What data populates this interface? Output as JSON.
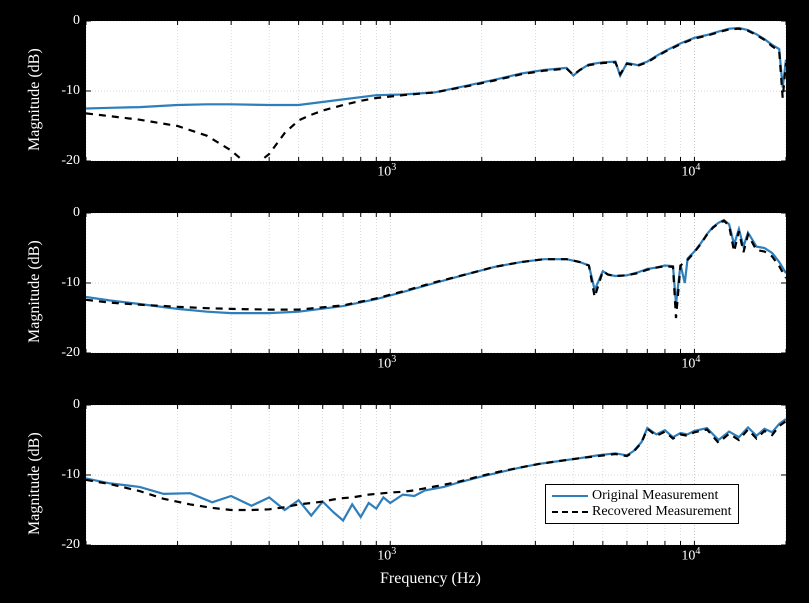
{
  "chart_data": [
    {
      "type": "line",
      "xscale": "log",
      "xlim": [
        100,
        20000
      ],
      "ylim": [
        -20,
        0
      ],
      "y_ticks": [
        -20,
        -10,
        0
      ],
      "x_ticks": [
        1000,
        10000
      ],
      "x_tick_labels": [
        "10^3",
        "10^4"
      ],
      "ylabel": "Magnitude (dB)",
      "series": [
        {
          "name": "Original Measurement",
          "style": "solid-blue",
          "x": [
            100,
            120,
            150,
            200,
            250,
            300,
            400,
            500,
            700,
            900,
            1100,
            1400,
            1800,
            2200,
            2700,
            3200,
            3800,
            4000,
            4200,
            4500,
            5000,
            5500,
            5700,
            6000,
            6500,
            7000,
            7500,
            8000,
            9000,
            10000,
            11000,
            12000,
            13000,
            14000,
            15000,
            16000,
            17000,
            18000,
            19000,
            19500,
            20000
          ],
          "y": [
            -12.5,
            -12.4,
            -12.3,
            -12.0,
            -11.9,
            -11.9,
            -12.0,
            -12.0,
            -11.2,
            -10.6,
            -10.5,
            -10.2,
            -9.2,
            -8.4,
            -7.5,
            -7.0,
            -6.7,
            -7.8,
            -7.0,
            -6.2,
            -5.9,
            -5.8,
            -7.8,
            -6.0,
            -6.3,
            -5.8,
            -5.0,
            -4.3,
            -3.2,
            -2.4,
            -2.0,
            -1.5,
            -1.1,
            -1.0,
            -1.3,
            -1.9,
            -2.6,
            -3.4,
            -4.0,
            -9.5,
            -5.5
          ]
        },
        {
          "name": "Recovered Measurement",
          "style": "dashed-black",
          "x": [
            100,
            120,
            150,
            200,
            250,
            300,
            350,
            400,
            450,
            500,
            550,
            600,
            700,
            800,
            900,
            1100,
            1400,
            1800,
            2200,
            2700,
            3200,
            3800,
            4000,
            4200,
            4500,
            5000,
            5500,
            5700,
            6000,
            6500,
            7000,
            7500,
            8000,
            9000,
            10000,
            11000,
            12000,
            13000,
            14000,
            15000,
            16000,
            17000,
            18000,
            19000,
            19500,
            20000
          ],
          "y": [
            -13.2,
            -13.6,
            -14.1,
            -15.0,
            -16.4,
            -18.5,
            -21.0,
            -19.0,
            -16.0,
            -14.2,
            -13.4,
            -12.8,
            -12.0,
            -11.4,
            -11.0,
            -10.6,
            -10.2,
            -9.3,
            -8.5,
            -7.6,
            -7.1,
            -6.8,
            -7.7,
            -7.0,
            -6.3,
            -6.0,
            -5.9,
            -7.6,
            -6.1,
            -6.4,
            -5.9,
            -5.1,
            -4.4,
            -3.3,
            -2.5,
            -2.1,
            -1.6,
            -1.2,
            -1.1,
            -1.4,
            -2.0,
            -2.7,
            -3.6,
            -4.3,
            -11.0,
            -6.0
          ]
        }
      ]
    },
    {
      "type": "line",
      "xscale": "log",
      "xlim": [
        100,
        20000
      ],
      "ylim": [
        -20,
        0
      ],
      "y_ticks": [
        -20,
        -10,
        0
      ],
      "x_ticks": [
        1000,
        10000
      ],
      "x_tick_labels": [
        "10^3",
        "10^4"
      ],
      "ylabel": "Magnitude (dB)",
      "series": [
        {
          "name": "Original Measurement",
          "style": "solid-blue",
          "x": [
            100,
            120,
            150,
            200,
            250,
            300,
            400,
            500,
            700,
            900,
            1100,
            1400,
            1800,
            2200,
            2700,
            3200,
            3800,
            4200,
            4500,
            4700,
            5000,
            5200,
            5500,
            6000,
            6500,
            7000,
            7500,
            8000,
            8500,
            8700,
            9000,
            9300,
            9500,
            10000,
            10500,
            11000,
            11500,
            12000,
            12500,
            13000,
            13500,
            14000,
            14500,
            15000,
            16000,
            17000,
            18000,
            19000,
            20000
          ],
          "y": [
            -12.0,
            -12.5,
            -13.0,
            -13.7,
            -14.1,
            -14.3,
            -14.3,
            -14.1,
            -13.3,
            -12.3,
            -11.3,
            -10.0,
            -8.7,
            -7.7,
            -7.0,
            -6.6,
            -6.6,
            -7.0,
            -7.5,
            -11.0,
            -8.3,
            -8.8,
            -9.0,
            -8.9,
            -8.5,
            -8.0,
            -7.8,
            -7.5,
            -7.6,
            -13.0,
            -7.4,
            -10.0,
            -6.5,
            -5.5,
            -4.3,
            -3.0,
            -2.0,
            -1.4,
            -1.0,
            -1.6,
            -4.5,
            -2.3,
            -4.8,
            -2.8,
            -4.8,
            -5.0,
            -5.7,
            -7.0,
            -8.6
          ]
        },
        {
          "name": "Recovered Measurement",
          "style": "dashed-black",
          "x": [
            100,
            120,
            150,
            200,
            250,
            300,
            400,
            500,
            700,
            900,
            1100,
            1400,
            1800,
            2200,
            2700,
            3200,
            3800,
            4200,
            4500,
            4700,
            5000,
            5200,
            5500,
            6000,
            6500,
            7000,
            7500,
            8000,
            8500,
            8700,
            9000,
            9300,
            9500,
            10000,
            10500,
            11000,
            11500,
            12000,
            12500,
            13000,
            13500,
            14000,
            14500,
            15000,
            16000,
            17000,
            18000,
            19000,
            20000
          ],
          "y": [
            -12.4,
            -12.8,
            -13.1,
            -13.4,
            -13.6,
            -13.7,
            -13.8,
            -13.8,
            -13.2,
            -12.2,
            -11.2,
            -9.9,
            -8.7,
            -7.7,
            -7.0,
            -6.6,
            -6.6,
            -7.0,
            -7.5,
            -12.0,
            -8.3,
            -8.8,
            -9.0,
            -8.9,
            -8.6,
            -8.1,
            -7.8,
            -7.6,
            -7.7,
            -15.0,
            -7.5,
            -7.0,
            -6.7,
            -5.6,
            -4.4,
            -3.1,
            -2.1,
            -1.5,
            -1.1,
            -1.8,
            -5.5,
            -2.6,
            -5.6,
            -3.1,
            -5.3,
            -5.5,
            -6.2,
            -7.6,
            -9.3
          ]
        }
      ]
    },
    {
      "type": "line",
      "xscale": "log",
      "xlim": [
        100,
        20000
      ],
      "ylim": [
        -20,
        0
      ],
      "y_ticks": [
        -20,
        -10,
        0
      ],
      "x_ticks": [
        1000,
        10000
      ],
      "x_tick_labels": [
        "10^3",
        "10^4"
      ],
      "ylabel": "Magnitude (dB)",
      "xlabel": "Frequency (Hz)",
      "legend": {
        "items": [
          "Original Measurement",
          "Recovered Measurement"
        ]
      },
      "series": [
        {
          "name": "Original Measurement",
          "style": "solid-blue",
          "x": [
            100,
            120,
            150,
            180,
            220,
            260,
            300,
            350,
            400,
            450,
            500,
            550,
            600,
            650,
            700,
            750,
            800,
            850,
            900,
            950,
            1000,
            1100,
            1200,
            1300,
            1500,
            1700,
            2000,
            2300,
            2700,
            3100,
            3600,
            4200,
            4800,
            5500,
            6000,
            6300,
            6700,
            7000,
            7500,
            8000,
            8500,
            9000,
            9500,
            10000,
            11000,
            12000,
            13000,
            14000,
            15000,
            16000,
            17000,
            18000,
            19000,
            20000
          ],
          "y": [
            -10.5,
            -11.2,
            -11.7,
            -12.7,
            -12.6,
            -13.9,
            -13.0,
            -14.4,
            -13.2,
            -15.0,
            -13.6,
            -15.8,
            -13.8,
            -15.3,
            -16.5,
            -14.2,
            -16.0,
            -14.0,
            -14.8,
            -13.2,
            -14.0,
            -12.8,
            -13.0,
            -12.2,
            -11.7,
            -11.0,
            -10.2,
            -9.6,
            -8.9,
            -8.4,
            -8.0,
            -7.6,
            -7.2,
            -6.9,
            -7.2,
            -6.6,
            -5.3,
            -3.3,
            -4.2,
            -3.6,
            -4.6,
            -4.0,
            -4.2,
            -3.7,
            -3.3,
            -5.0,
            -3.8,
            -4.6,
            -3.2,
            -4.4,
            -3.4,
            -3.9,
            -2.7,
            -2.0
          ]
        },
        {
          "name": "Recovered Measurement",
          "style": "dashed-black",
          "x": [
            100,
            120,
            150,
            180,
            220,
            260,
            300,
            350,
            400,
            450,
            500,
            550,
            600,
            650,
            700,
            750,
            800,
            850,
            900,
            950,
            1000,
            1100,
            1200,
            1300,
            1500,
            1700,
            2000,
            2300,
            2700,
            3100,
            3600,
            4200,
            4800,
            5500,
            6000,
            6300,
            6700,
            7000,
            7500,
            8000,
            8500,
            9000,
            9500,
            10000,
            11000,
            12000,
            13000,
            14000,
            15000,
            16000,
            17000,
            18000,
            19000,
            20000
          ],
          "y": [
            -10.7,
            -11.3,
            -12.3,
            -13.4,
            -14.2,
            -14.7,
            -15.0,
            -15.0,
            -14.9,
            -14.6,
            -14.2,
            -14.0,
            -13.8,
            -13.5,
            -13.3,
            -13.2,
            -13.0,
            -12.8,
            -12.7,
            -12.6,
            -12.5,
            -12.4,
            -12.2,
            -11.9,
            -11.4,
            -10.9,
            -10.1,
            -9.5,
            -8.9,
            -8.4,
            -8.0,
            -7.6,
            -7.3,
            -7.0,
            -7.3,
            -6.7,
            -5.4,
            -3.4,
            -4.4,
            -3.8,
            -4.8,
            -4.2,
            -4.4,
            -3.9,
            -3.5,
            -5.4,
            -4.1,
            -5.0,
            -3.5,
            -4.8,
            -3.7,
            -4.3,
            -3.0,
            -2.3
          ]
        }
      ]
    }
  ],
  "labels": {
    "ylabel": "Magnitude (dB)",
    "xlabel": "Frequency (Hz)",
    "legend_original": "Original Measurement",
    "legend_recovered": "Recovered Measurement",
    "xtick1": "10",
    "xtick1_sup": "3",
    "xtick2": "10",
    "xtick2_sup": "4",
    "ytick0": "-20",
    "ytick1": "-10",
    "ytick2": "0"
  }
}
